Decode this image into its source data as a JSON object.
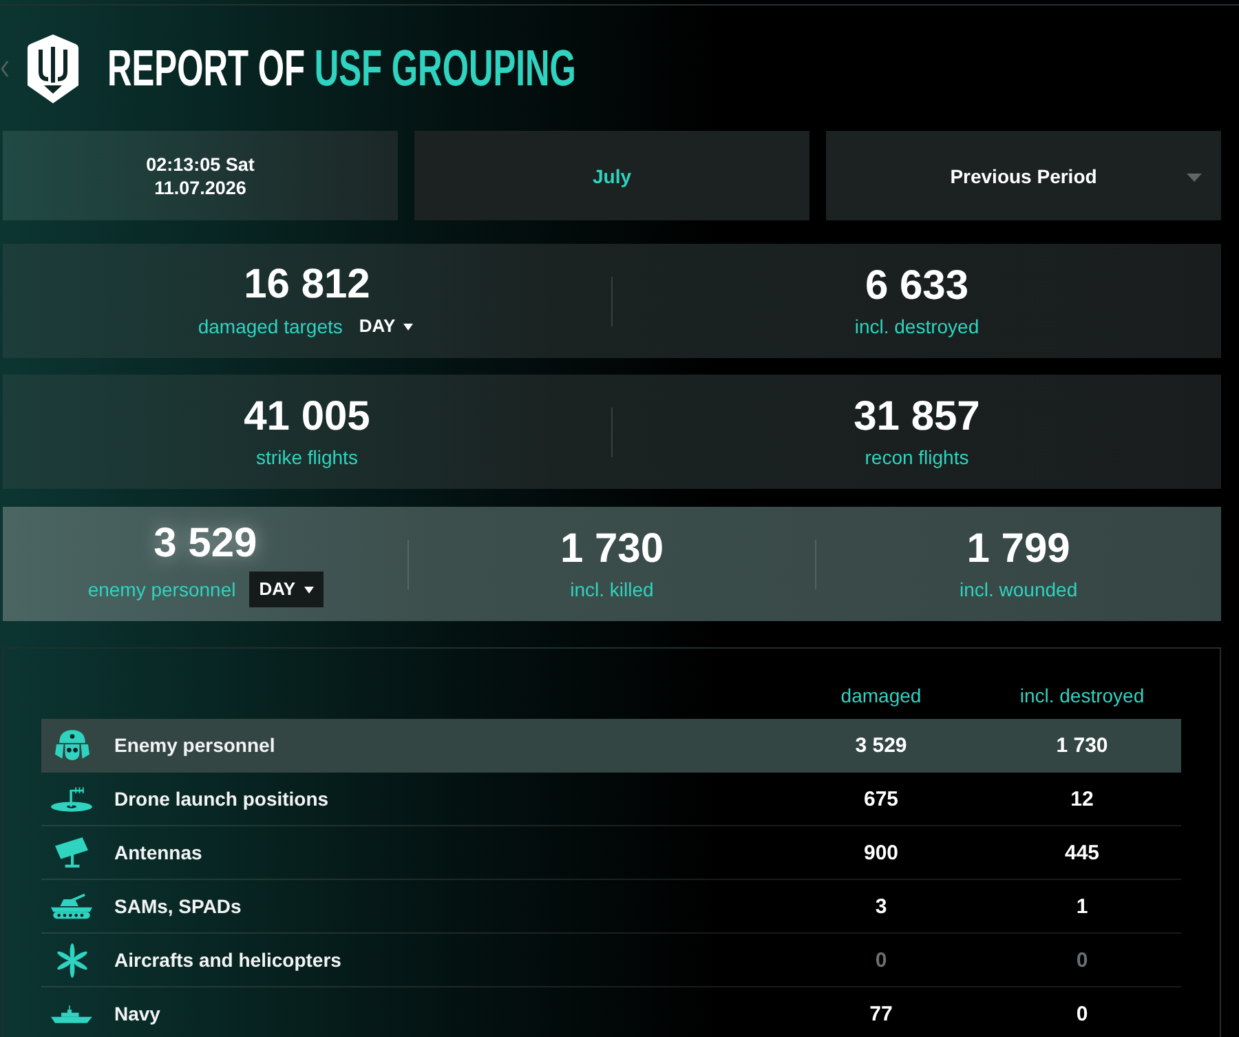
{
  "header": {
    "title": "REPORT OF",
    "title_highlight": "USF GROUPING"
  },
  "filters": [
    {
      "kind": "clock",
      "lines": [
        "02:13:05 Sat",
        "11.07.2026"
      ]
    },
    {
      "kind": "month",
      "label": "July"
    },
    {
      "kind": "select",
      "label": "Previous Period"
    }
  ],
  "stat_panels": [
    {
      "selected": false,
      "items": [
        {
          "value": "16 812",
          "label": "damaged targets",
          "dropdown": "DAY"
        },
        {
          "value": "6 633",
          "label": "incl. destroyed"
        }
      ]
    },
    {
      "selected": false,
      "items": [
        {
          "value": "41 005",
          "label": "strike flights"
        },
        {
          "value": "31 857",
          "label": "recon flights"
        }
      ]
    },
    {
      "selected": true,
      "items": [
        {
          "value": "3 529",
          "label": "enemy personnel",
          "dropdown": "DAY"
        },
        {
          "value": "1 730",
          "label": "incl. killed"
        },
        {
          "value": "1 799",
          "label": "incl. wounded"
        }
      ]
    }
  ],
  "table": {
    "columns": [
      "damaged",
      "incl. destroyed"
    ],
    "rows": [
      {
        "name": "Enemy personnel",
        "damaged": "3 529",
        "destroyed": "1 730",
        "selected": true,
        "dimmed": false
      },
      {
        "name": "Drone launch positions",
        "damaged": "675",
        "destroyed": "12",
        "selected": false,
        "dimmed": false
      },
      {
        "name": "Antennas",
        "damaged": "900",
        "destroyed": "445",
        "selected": false,
        "dimmed": false
      },
      {
        "name": "SAMs, SPADs",
        "damaged": "3",
        "destroyed": "1",
        "selected": false,
        "dimmed": false
      },
      {
        "name": "Aircrafts and helicopters",
        "damaged": "0",
        "destroyed": "0",
        "selected": false,
        "dimmed": true
      },
      {
        "name": "Navy",
        "damaged": "77",
        "destroyed": "0",
        "selected": false,
        "dimmed": false
      }
    ]
  }
}
